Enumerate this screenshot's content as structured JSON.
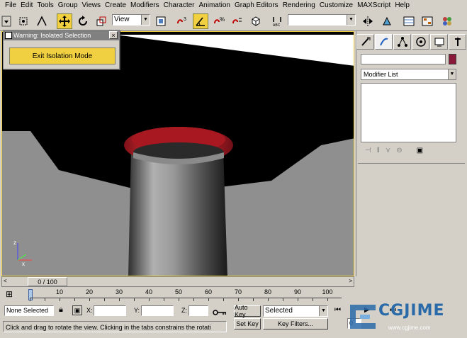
{
  "menu": [
    "File",
    "Edit",
    "Tools",
    "Group",
    "Views",
    "Create",
    "Modifiers",
    "Character",
    "Animation",
    "Graph Editors",
    "Rendering",
    "Customize",
    "MAXScript",
    "Help"
  ],
  "toolbar": {
    "view_select": "View",
    "active_tool": "select-and-move"
  },
  "isolation_dialog": {
    "title": "Warning: Isolated Selection",
    "close_label": "×",
    "exit_button": "Exit Isolation Mode"
  },
  "command_panel": {
    "object_color": "#8a1a3a",
    "modifier_list": "Modifier List"
  },
  "time_slider": {
    "label": "0 / 100",
    "left_arrow": "<",
    "right_arrow": ">"
  },
  "track_bar": {
    "ticks": [
      "10",
      "20",
      "30",
      "40",
      "50",
      "60",
      "70",
      "80",
      "90",
      "100"
    ]
  },
  "status": {
    "selection": "None Selected",
    "x_label": "X:",
    "y_label": "Y:",
    "z_label": "Z:",
    "auto_key": "Auto Key",
    "set_key": "Set Key",
    "key_mode": "Selected",
    "key_filters": "Key Filters...",
    "prompt": "Click and drag to rotate the view.  Clicking in the tabs constrains the rotati",
    "frame": "0"
  },
  "colors": {
    "accent_yellow": "#f0d040",
    "ui_gray": "#d4d0c8",
    "cylinder_cap": "#c0202a"
  },
  "watermark": {
    "logo": "CGJIME",
    "url": "www.cgjime.com"
  }
}
